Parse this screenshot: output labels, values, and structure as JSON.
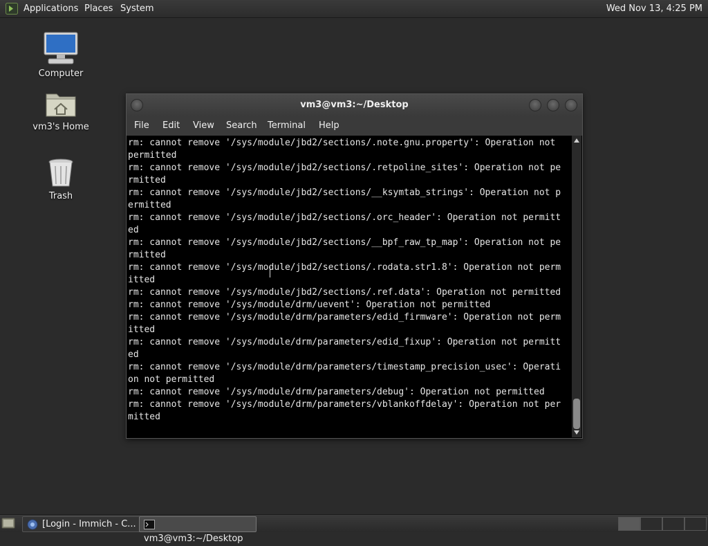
{
  "top_panel": {
    "menus": [
      "Applications",
      "Places",
      "System"
    ],
    "clock": "Wed Nov 13,  4:25 PM"
  },
  "desktop": {
    "icons": [
      {
        "label": "Computer",
        "icon": "computer-icon"
      },
      {
        "label": "vm3's Home",
        "icon": "home-folder-icon"
      },
      {
        "label": "Trash",
        "icon": "trash-icon"
      }
    ]
  },
  "window": {
    "title": "vm3@vm3:~/Desktop",
    "menu": [
      "File",
      "Edit",
      "View",
      "Search",
      "Terminal",
      "Help"
    ],
    "lines": [
      "rm: cannot remove '/sys/module/jbd2/sections/.note.gnu.property': Operation not ",
      "permitted",
      "rm: cannot remove '/sys/module/jbd2/sections/.retpoline_sites': Operation not pe",
      "rmitted",
      "rm: cannot remove '/sys/module/jbd2/sections/__ksymtab_strings': Operation not p",
      "ermitted",
      "rm: cannot remove '/sys/module/jbd2/sections/.orc_header': Operation not permitt",
      "ed",
      "rm: cannot remove '/sys/module/jbd2/sections/__bpf_raw_tp_map': Operation not pe",
      "rmitted",
      "rm: cannot remove '/sys/module/jbd2/sections/.rodata.str1.8': Operation not perm",
      "itted",
      "rm: cannot remove '/sys/module/jbd2/sections/.ref.data': Operation not permitted",
      "rm: cannot remove '/sys/module/drm/uevent': Operation not permitted",
      "rm: cannot remove '/sys/module/drm/parameters/edid_firmware': Operation not perm",
      "itted",
      "rm: cannot remove '/sys/module/drm/parameters/edid_fixup': Operation not permitt",
      "ed",
      "rm: cannot remove '/sys/module/drm/parameters/timestamp_precision_usec': Operati",
      "on not permitted",
      "rm: cannot remove '/sys/module/drm/parameters/debug': Operation not permitted",
      "rm: cannot remove '/sys/module/drm/parameters/vblankoffdelay': Operation not per",
      "mitted"
    ]
  },
  "taskbar": {
    "tasks": [
      {
        "label": "[Login - Immich - C...",
        "icon": "browser-icon",
        "active": false
      },
      {
        "label": "vm3@vm3:~/Desktop",
        "icon": "terminal-icon",
        "active": true
      }
    ]
  }
}
